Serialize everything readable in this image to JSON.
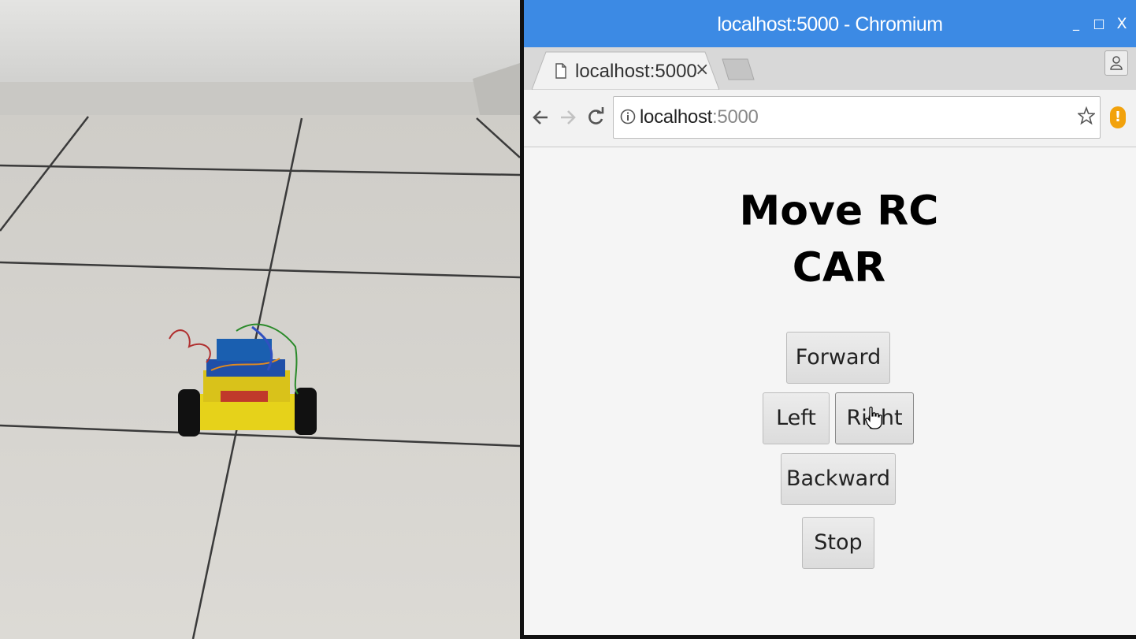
{
  "window": {
    "title": "localhost:5000 - Chromium",
    "controls": {
      "minimize": "_",
      "maximize": "□",
      "close": "X"
    }
  },
  "tab": {
    "title": "localhost:5000",
    "close": "×"
  },
  "address_bar": {
    "host": "localhost",
    "port": ":5000"
  },
  "page": {
    "heading_line1": "Move RC",
    "heading_line2": "CAR",
    "buttons": {
      "forward": "Forward",
      "left": "Left",
      "right": "Right",
      "backward": "Backward",
      "stop": "Stop"
    }
  },
  "colors": {
    "titlebar": "#3c8ae4",
    "alert": "#f2a20c"
  },
  "icons": [
    "document-icon",
    "back-arrow-icon",
    "forward-arrow-icon",
    "reload-icon",
    "info-icon",
    "star-icon",
    "alert-icon",
    "profile-icon",
    "hand-cursor-icon"
  ]
}
